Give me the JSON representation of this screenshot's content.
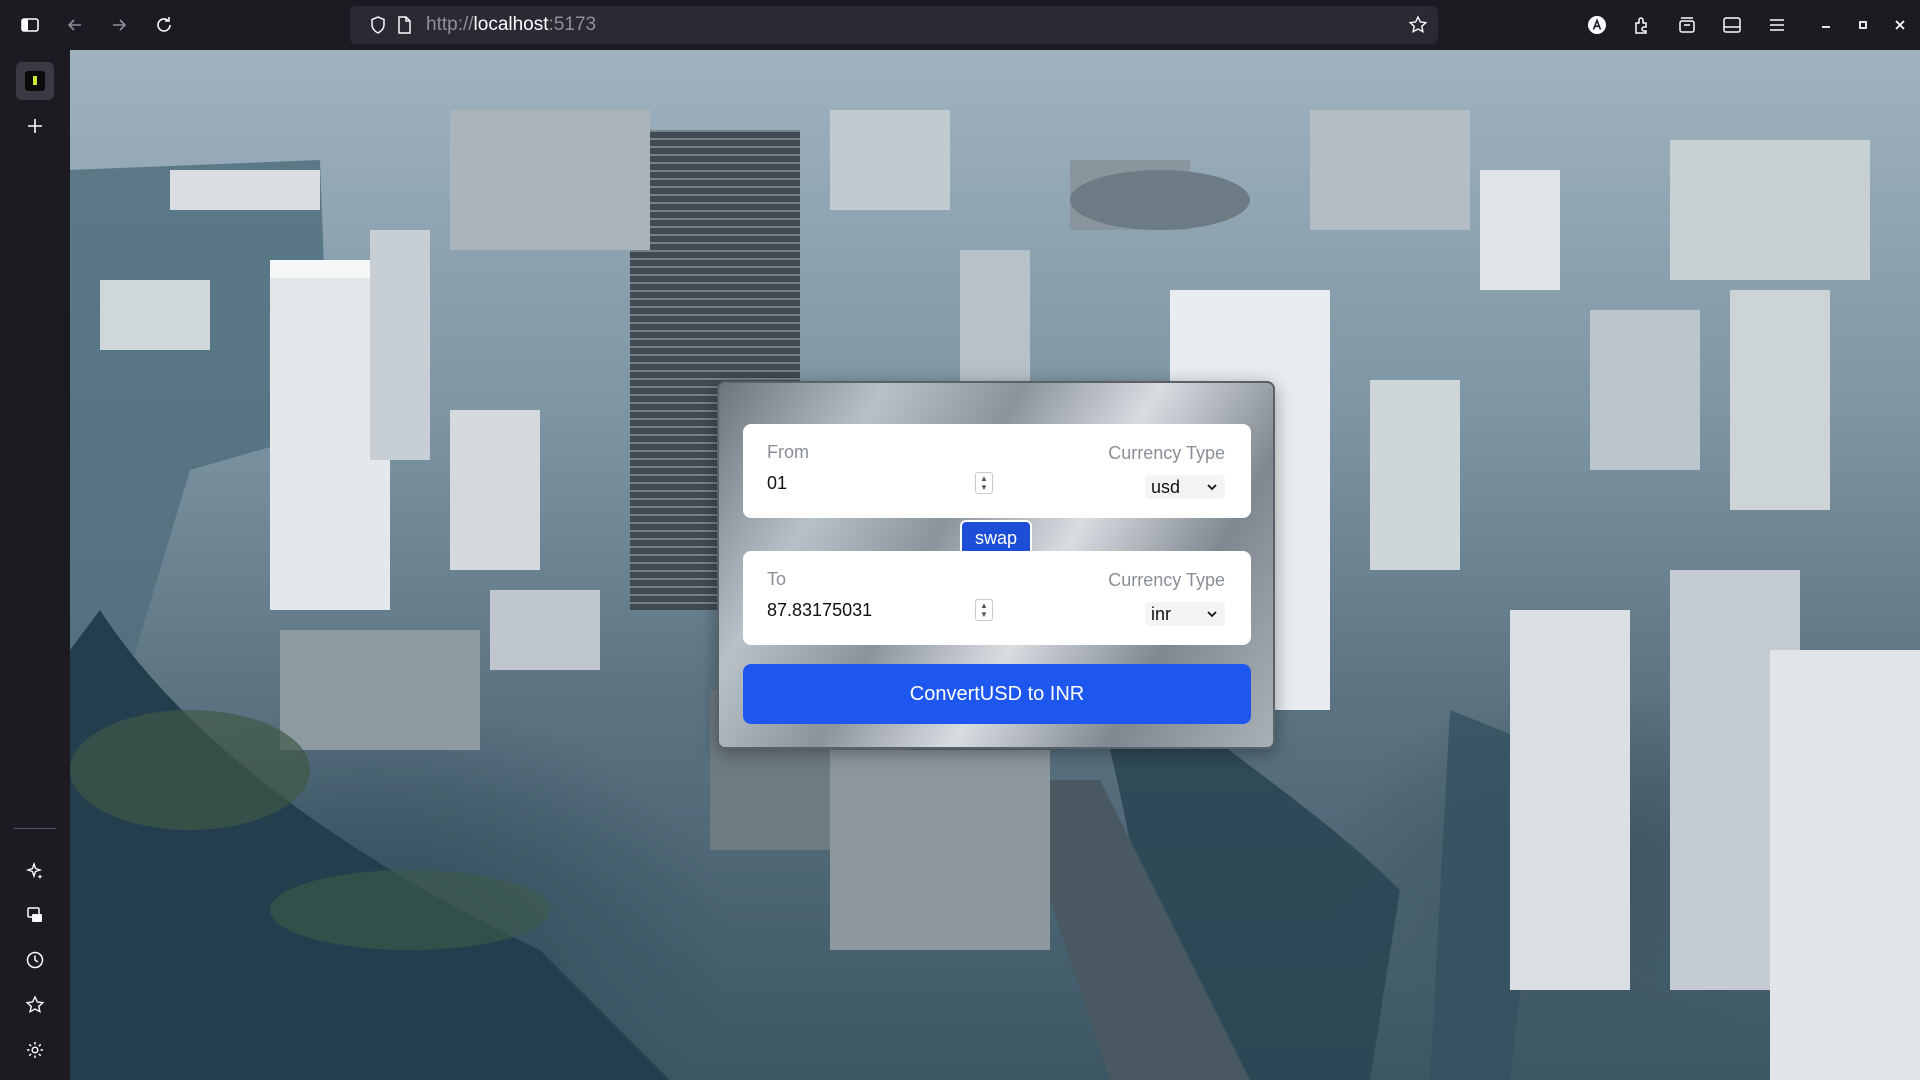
{
  "browser": {
    "url_protocol": "http://",
    "url_host": "localhost",
    "url_port": ":5173"
  },
  "converter": {
    "from": {
      "label": "From",
      "amount": "01",
      "currency_label": "Currency Type",
      "currency": "usd"
    },
    "swap_label": "swap",
    "to": {
      "label": "To",
      "amount": "87.83175031",
      "currency_label": "Currency Type",
      "currency": "inr"
    },
    "convert_label": "ConvertUSD to INR"
  },
  "colors": {
    "accent": "#1d57f0",
    "swap": "#1d4ed8",
    "browser_bg": "#1c1b22"
  },
  "icons": {
    "toolbar_left": [
      "sidebar-toggle-icon",
      "back-arrow-icon",
      "forward-arrow-icon",
      "reload-icon"
    ],
    "urlbar": [
      "shield-icon",
      "page-icon",
      "bookmark-star-icon"
    ],
    "toolbar_right": [
      "account-icon",
      "extensions-icon",
      "container-icon",
      "reader-view-icon",
      "menu-icon",
      "minimize-icon",
      "maximize-icon",
      "close-icon"
    ],
    "sidebar": [
      "new-tab-plus-icon",
      "ai-chatbot-icon",
      "synced-tabs-icon",
      "history-icon",
      "bookmarks-icon",
      "settings-gear-icon"
    ]
  }
}
